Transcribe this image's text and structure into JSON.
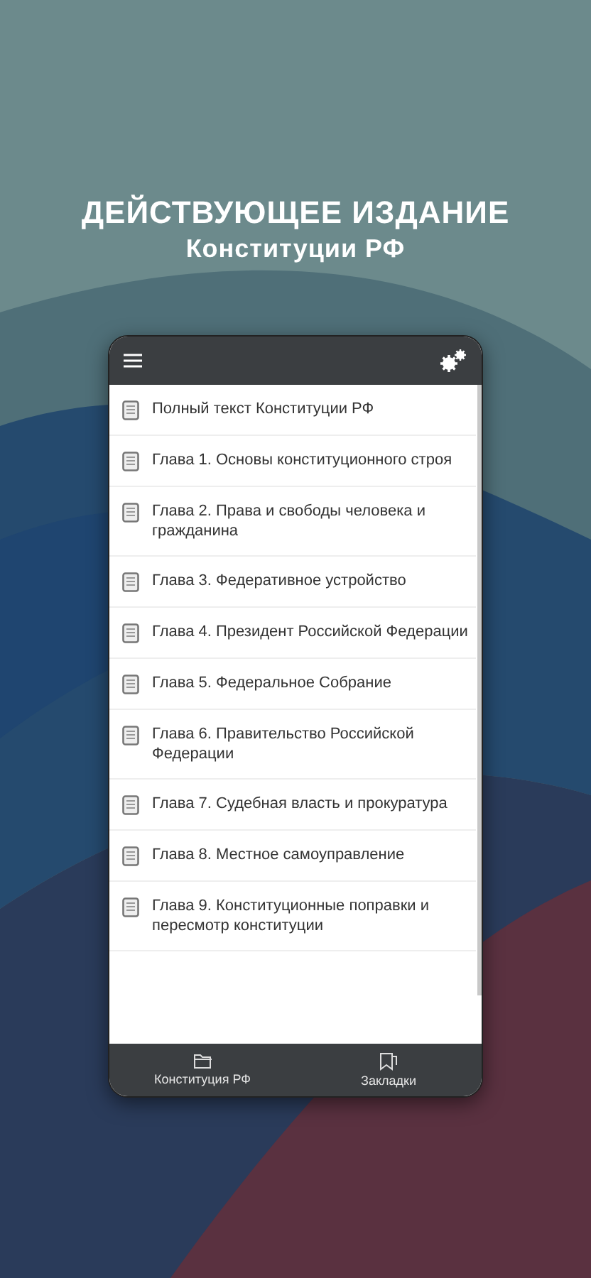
{
  "headline": "ДЕЙСТВУЮЩЕЕ ИЗДАНИЕ",
  "subheadline": "Конституции РФ",
  "chapters": [
    {
      "title": "Полный текст Конституции РФ"
    },
    {
      "title": "Глава 1. Основы конституционного строя"
    },
    {
      "title": "Глава 2. Права и свободы человека и гражданина"
    },
    {
      "title": "Глава 3. Федеративное устройство"
    },
    {
      "title": "Глава 4. Президент Российской Федерации"
    },
    {
      "title": "Глава 5. Федеральное Собрание"
    },
    {
      "title": "Глава 6. Правительство Российской Федерации"
    },
    {
      "title": "Глава 7. Судебная власть и прокуратура"
    },
    {
      "title": "Глава 8. Местное самоуправление"
    },
    {
      "title": "Глава 9. Конституционные поправки и пересмотр конституции"
    }
  ],
  "bottom_nav": [
    {
      "kind": "folder",
      "label": "Конституция РФ"
    },
    {
      "kind": "bookmark",
      "label": "Закладки"
    }
  ]
}
